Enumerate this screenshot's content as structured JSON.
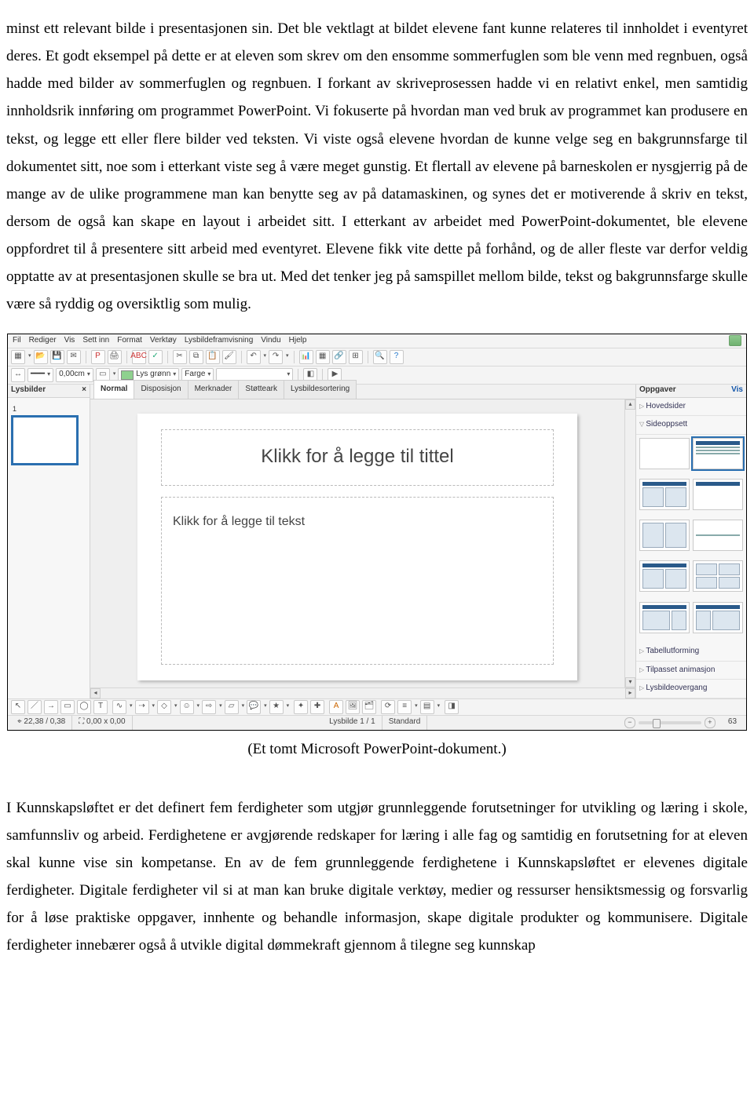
{
  "paragraph1": "minst ett relevant bilde i presentasjonen sin. Det ble vektlagt at bildet elevene fant kunne relateres til innholdet i eventyret deres. Et godt eksempel på dette er at eleven som skrev om den ensomme sommerfuglen som ble venn med regnbuen, også hadde med bilder av sommerfuglen og regnbuen. I forkant av skriveprosessen hadde vi en relativt enkel, men samtidig innholdsrik innføring om programmet PowerPoint. Vi fokuserte på hvordan man ved bruk av programmet kan produsere en tekst, og legge ett eller flere bilder ved teksten. Vi viste også elevene hvordan de kunne velge seg en bakgrunnsfarge til dokumentet sitt, noe som i etterkant viste seg å være meget gunstig. Et flertall av elevene på barneskolen er nysgjerrig på de mange av de ulike programmene man kan benytte seg av på datamaskinen, og synes det er motiverende å skriv en tekst, dersom de også kan skape en layout i arbeidet sitt. I etterkant av arbeidet med PowerPoint-dokumentet, ble elevene oppfordret til å presentere sitt arbeid med eventyret. Elevene fikk vite dette på forhånd, og de aller fleste var derfor veldig opptatte av at presentasjonen skulle se bra ut. Med det tenker jeg på samspillet mellom bilde, tekst og bakgrunnsfarge skulle være så ryddig og oversiktlig som mulig.",
  "caption": "(Et tomt Microsoft PowerPoint-dokument.)",
  "paragraph2": "I Kunnskapsløftet er det definert fem ferdigheter som utgjør grunnleggende forutsetninger for utvikling og læring i skole, samfunnsliv og arbeid. Ferdighetene er avgjørende redskaper for læring i alle fag og samtidig en forutsetning for at eleven skal kunne vise sin kompetanse. En av de fem grunnleggende ferdighetene i Kunnskapsløftet er elevenes digitale ferdigheter. Digitale ferdigheter vil si at man kan bruke digitale verktøy, medier og ressurser hensiktsmessig og forsvarlig for å løse praktiske oppgaver, innhente og behandle informasjon, skape digitale produkter og kommunisere. Digitale ferdigheter innebærer også å utvikle digital dømmekraft gjennom å tilegne seg kunnskap",
  "app": {
    "menus": [
      "Fil",
      "Rediger",
      "Vis",
      "Sett inn",
      "Format",
      "Verktøy",
      "Lysbildeframvisning",
      "Vindu",
      "Hjelp"
    ],
    "toolbar2": {
      "pos_value": "0,00cm",
      "color_name": "Lys grønn",
      "color_label": "Farge"
    },
    "left_header": "Lysbilder",
    "thumb_number": "1",
    "view_tabs": [
      "Normal",
      "Disposisjon",
      "Merknader",
      "Støtteark",
      "Lysbildesortering"
    ],
    "slide_title_ph": "Klikk for å legge til tittel",
    "slide_body_ph": "Klikk for å legge til tekst",
    "right_header": "Oppgaver",
    "right_view": "Vis",
    "sections": {
      "hovedsider": "Hovedsider",
      "sideoppsett": "Sideoppsett",
      "tabell": "Tabellutforming",
      "anim": "Tilpasset animasjon",
      "overgang": "Lysbildeovergang"
    },
    "status": {
      "coord1": "22,38 / 0,38",
      "coord2": "0,00 x 0,00",
      "slide": "Lysbilde 1 / 1",
      "std": "Standard",
      "zoom": "63"
    }
  }
}
